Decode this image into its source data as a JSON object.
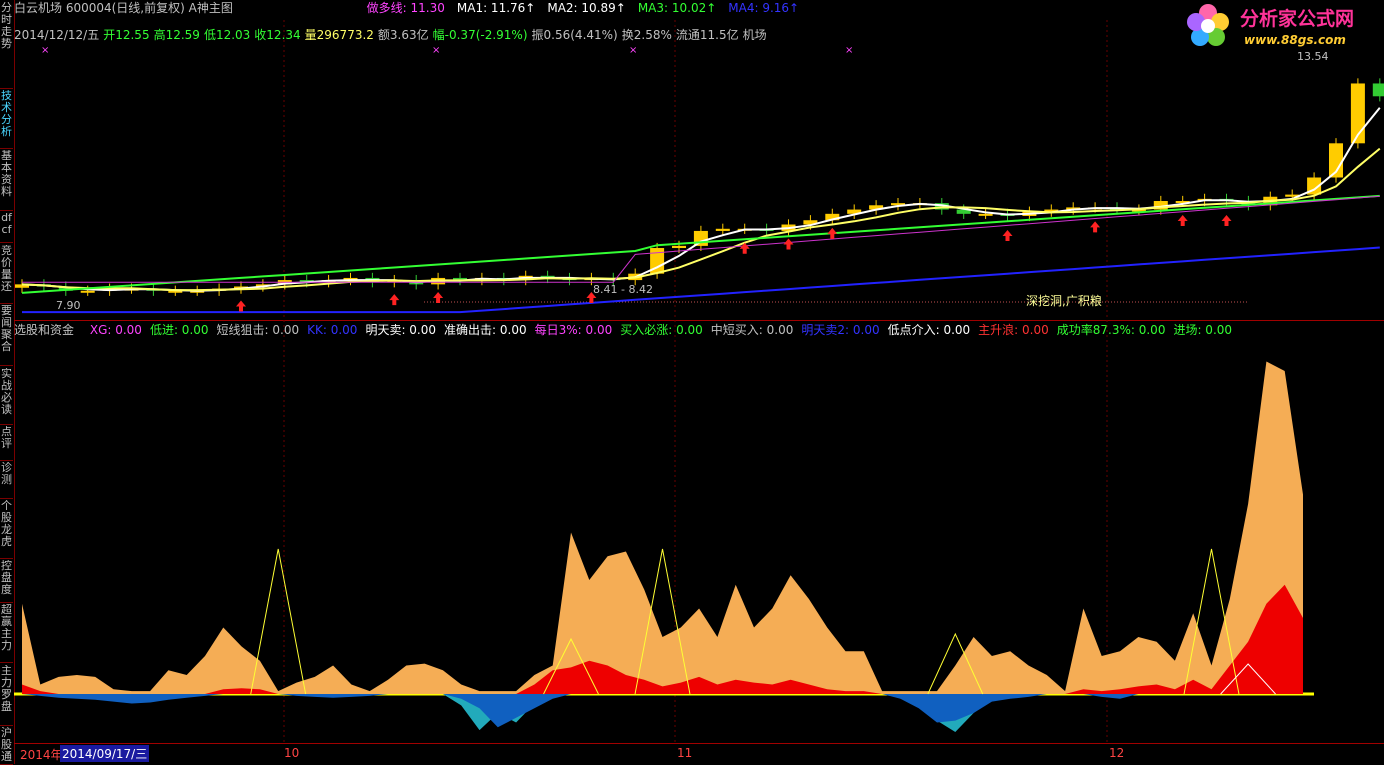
{
  "sidebar": {
    "tabs": [
      {
        "label": "分时走势",
        "active": false
      },
      {
        "label": "技术分析",
        "active": true
      },
      {
        "label": "基本资料",
        "active": false
      },
      {
        "label": "df cf",
        "active": false
      },
      {
        "label": "竞价量还",
        "active": false
      },
      {
        "label": "要闻聚合",
        "active": false
      },
      {
        "label": "实战必读",
        "active": false
      },
      {
        "label": "点评",
        "active": false
      },
      {
        "label": "诊测",
        "active": false
      },
      {
        "label": "个股龙虎",
        "active": false
      },
      {
        "label": "控盘度",
        "active": false
      },
      {
        "label": "超赢主力",
        "active": false
      },
      {
        "label": "主力罗盘",
        "active": false
      },
      {
        "label": "沪股通",
        "active": false
      }
    ]
  },
  "header": {
    "stock": "白云机场 600004(日线,前复权) A神主图",
    "ma_items": [
      {
        "text": "做多线: 11.30",
        "color": "#ff44ff"
      },
      {
        "text": "MA1: 11.76↑",
        "color": "#ffffff"
      },
      {
        "text": "MA2: 10.89↑",
        "color": "#ffffff"
      },
      {
        "text": "MA3: 10.02↑",
        "color": "#33ff33"
      },
      {
        "text": "MA4: 9.16↑",
        "color": "#3333ff"
      }
    ]
  },
  "logo": {
    "title": "分析家公式网",
    "url": "www.88gs.com"
  },
  "quote": {
    "items": [
      {
        "text": "2014/12/12/五",
        "color": "#c0c0c0"
      },
      {
        "text": "开12.55",
        "color": "#33ff33"
      },
      {
        "text": "高12.59",
        "color": "#33ff33"
      },
      {
        "text": "低12.03",
        "color": "#33ff33"
      },
      {
        "text": "收12.34",
        "color": "#33ff33"
      },
      {
        "text": "量296773.2",
        "color": "#ffff66"
      },
      {
        "text": "额3.63亿",
        "color": "#c0c0c0"
      },
      {
        "text": "幅-0.37(-2.91%)",
        "color": "#33ff33"
      },
      {
        "text": "振0.56(4.41%)",
        "color": "#c0c0c0"
      },
      {
        "text": "换2.58%",
        "color": "#c0c0c0"
      },
      {
        "text": "流通11.5亿",
        "color": "#c0c0c0"
      },
      {
        "text": "机场",
        "color": "#c0c0c0"
      }
    ]
  },
  "price_chart": {
    "high_label": "13.54",
    "low_label": "7.90",
    "range_label": "8.41 - 8.42",
    "annotation": "深挖洞,广积粮",
    "markers": [
      "×",
      "×",
      "×",
      "×"
    ]
  },
  "indicator": {
    "title": "选股和资金",
    "items": [
      {
        "text": "XG: 0.00",
        "color": "#ff44ff"
      },
      {
        "text": "低进: 0.00",
        "color": "#33ff33"
      },
      {
        "text": "短线狙击: 0.00",
        "color": "#c0c0c0"
      },
      {
        "text": "KK: 0.00",
        "color": "#3333ff"
      },
      {
        "text": "明天卖: 0.00",
        "color": "#ffffff"
      },
      {
        "text": "准确出击: 0.00",
        "color": "#ffffff"
      },
      {
        "text": "每日3%: 0.00",
        "color": "#ff44ff"
      },
      {
        "text": "买入必涨: 0.00",
        "color": "#33ff33"
      },
      {
        "text": "中短买入: 0.00",
        "color": "#c0c0c0"
      },
      {
        "text": "明天卖2: 0.00",
        "color": "#3333ff"
      },
      {
        "text": "低点介入: 0.00",
        "color": "#ffffff"
      },
      {
        "text": "主升浪: 0.00",
        "color": "#ff3333"
      },
      {
        "text": "成功率87.3%: 0.00",
        "color": "#33ff33"
      },
      {
        "text": "进场: 0.00",
        "color": "#33ff33"
      }
    ]
  },
  "date_axis": {
    "start_year": "2014年",
    "cursor_date": "2014/09/17/三",
    "months": [
      "10",
      "11",
      "12"
    ]
  },
  "colors": {
    "up_candle": "#ffcc00",
    "down_candle": "#33cc33",
    "ma1": "#ffffff",
    "ma2": "#ffff66",
    "ma3": "#33ff33",
    "ma4": "#2222ff",
    "orange_area": "#f5ad55",
    "red_area": "#ee0000",
    "blue_area": "#1060c0",
    "cyan_area": "#22aabb"
  }
}
